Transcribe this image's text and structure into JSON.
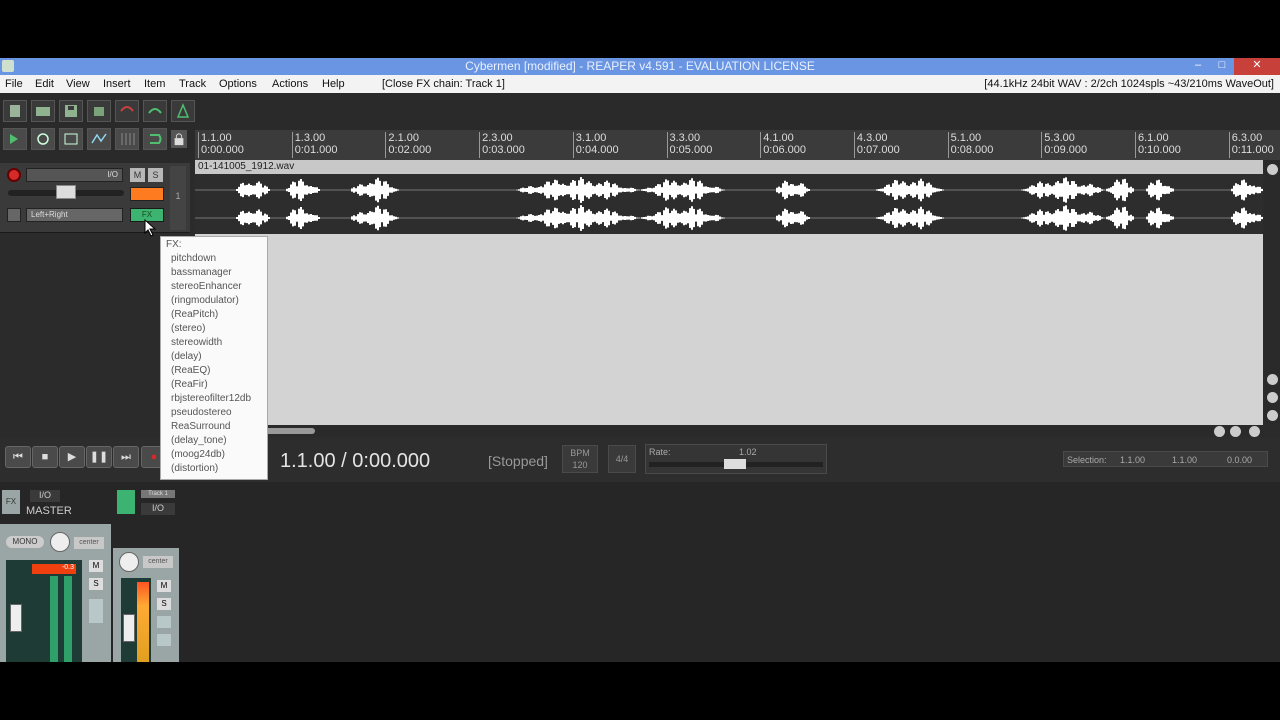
{
  "window": {
    "title": "Cybermen [modified] - REAPER v4.591 - EVALUATION LICENSE",
    "minimize": "–",
    "maximize": "□",
    "close": "✕"
  },
  "menubar": {
    "items": [
      "File",
      "Edit",
      "View",
      "Insert",
      "Item",
      "Track",
      "Options",
      "Actions",
      "Help"
    ],
    "action_hint": "[Close FX chain: Track 1]",
    "audio_status": "[44.1kHz 24bit WAV : 2/2ch 1024spls ~43/210ms WaveOut]"
  },
  "ruler": {
    "ticks": [
      {
        "bar": "1.1.00",
        "time": "0:00.000"
      },
      {
        "bar": "1.3.00",
        "time": "0:01.000"
      },
      {
        "bar": "2.1.00",
        "time": "0:02.000"
      },
      {
        "bar": "2.3.00",
        "time": "0:03.000"
      },
      {
        "bar": "3.1.00",
        "time": "0:04.000"
      },
      {
        "bar": "3.3.00",
        "time": "0:05.000"
      },
      {
        "bar": "4.1.00",
        "time": "0:06.000"
      },
      {
        "bar": "4.3.00",
        "time": "0:07.000"
      },
      {
        "bar": "5.1.00",
        "time": "0:08.000"
      },
      {
        "bar": "5.3.00",
        "time": "0:09.000"
      },
      {
        "bar": "6.1.00",
        "time": "0:10.000"
      },
      {
        "bar": "6.3.00",
        "time": "0:11.000"
      }
    ]
  },
  "track": {
    "number": "1",
    "io_label": "I/O",
    "mute": "M",
    "solo": "S",
    "pan_label": "Left+Right",
    "item_name": "01-141005_1912.wav",
    "fx_label": "FX"
  },
  "fx_menu": {
    "header": "FX:",
    "items": [
      "pitchdown",
      "bassmanager",
      "stereoEnhancer",
      "(ringmodulator)",
      "(ReaPitch)",
      "(stereo)",
      "stereowidth",
      "(delay)",
      "(ReaEQ)",
      "(ReaFir)",
      "rbjstereofilter12db",
      "pseudostereo",
      "ReaSurround",
      "(delay_tone)",
      "(moog24db)",
      "(distortion)"
    ]
  },
  "transport": {
    "position": "1.1.00 / 0:00.000",
    "state": "[Stopped]",
    "bpm_label": "BPM",
    "bpm": "120",
    "time_sig": "4/4",
    "rate_label": "Rate:",
    "rate": "1.02",
    "selection_label": "Selection:",
    "selection_start": "1.1.00",
    "selection_end": "1.1.00",
    "selection_len": "0.0.00"
  },
  "mixer": {
    "master_label": "MASTER",
    "io_label": "I/O",
    "fx_label": "FX",
    "mono_label": "MONO",
    "center_label": "center",
    "master_peak": "-0.3",
    "mute": "M",
    "solo": "S",
    "track_name": "Track 1"
  },
  "colors": {
    "title_bar": "#6a95e3",
    "waveform": "#ffffff",
    "record_arm": "#d42a2a",
    "fx_active": "#3cb371"
  }
}
